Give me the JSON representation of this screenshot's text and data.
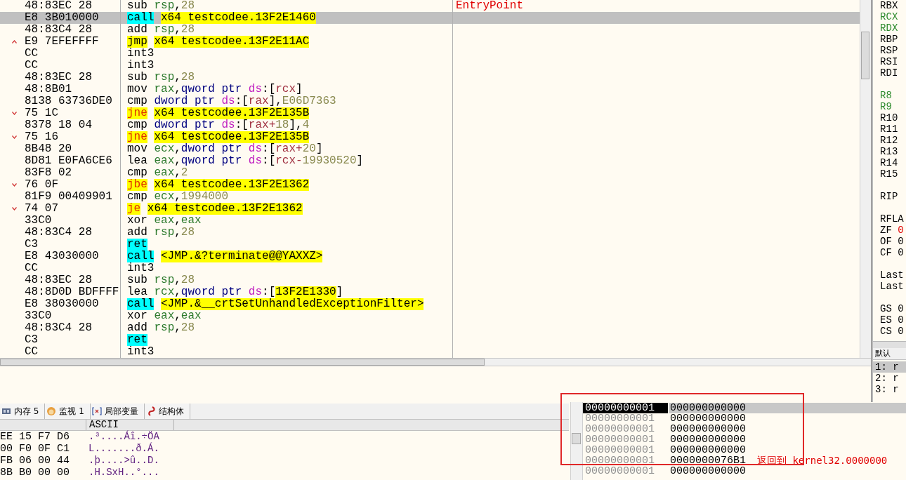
{
  "disassembly": {
    "rows": [
      {
        "bytes": "48:83EC 28",
        "jump_up": false,
        "jump_down": false,
        "selected": false,
        "mnemonic": "sub",
        "kind": "plain",
        "operands": [
          {
            "text": "rsp",
            "kind": "reg"
          },
          {
            "text": ",",
            "kind": "sym"
          },
          {
            "text": "28",
            "kind": "num"
          }
        ],
        "comment": "EntryPoint"
      },
      {
        "bytes": "E8 3B010000",
        "jump_up": false,
        "jump_down": false,
        "selected": true,
        "mnemonic": "call",
        "kind": "call",
        "operands": [
          {
            "text": "x64 testcodee.13F2E1460",
            "kind": "target"
          }
        ]
      },
      {
        "bytes": "48:83C4 28",
        "jump_up": false,
        "jump_down": false,
        "selected": false,
        "mnemonic": "add",
        "kind": "plain",
        "operands": [
          {
            "text": "rsp",
            "kind": "reg"
          },
          {
            "text": ",",
            "kind": "sym"
          },
          {
            "text": "28",
            "kind": "num"
          }
        ]
      },
      {
        "bytes": "E9 7EFEFFFF",
        "jump_up": true,
        "jump_down": false,
        "selected": false,
        "mnemonic": "jmp",
        "kind": "jmp",
        "operands": [
          {
            "text": "x64 testcodee.13F2E11AC",
            "kind": "target"
          }
        ]
      },
      {
        "bytes": "CC",
        "jump_up": false,
        "jump_down": false,
        "selected": false,
        "mnemonic": "int3",
        "kind": "plain",
        "operands": []
      },
      {
        "bytes": "CC",
        "jump_up": false,
        "jump_down": false,
        "selected": false,
        "mnemonic": "int3",
        "kind": "plain",
        "operands": []
      },
      {
        "bytes": "48:83EC 28",
        "jump_up": false,
        "jump_down": false,
        "selected": false,
        "mnemonic": "sub",
        "kind": "plain",
        "operands": [
          {
            "text": "rsp",
            "kind": "reg"
          },
          {
            "text": ",",
            "kind": "sym"
          },
          {
            "text": "28",
            "kind": "num"
          }
        ]
      },
      {
        "bytes": "48:8B01",
        "jump_up": false,
        "jump_down": false,
        "selected": false,
        "mnemonic": "mov",
        "kind": "plain",
        "operands": [
          {
            "text": "rax",
            "kind": "reg"
          },
          {
            "text": ",",
            "kind": "sym"
          },
          {
            "text": "qword ptr ",
            "kind": "size"
          },
          {
            "text": "ds",
            "kind": "seg"
          },
          {
            "text": ":[",
            "kind": "sym"
          },
          {
            "text": "rcx",
            "kind": "memreg"
          },
          {
            "text": "]",
            "kind": "sym"
          }
        ]
      },
      {
        "bytes": "8138 63736DE0",
        "jump_up": false,
        "jump_down": false,
        "selected": false,
        "mnemonic": "cmp",
        "kind": "plain",
        "operands": [
          {
            "text": "dword ptr ",
            "kind": "size"
          },
          {
            "text": "ds",
            "kind": "seg"
          },
          {
            "text": ":[",
            "kind": "sym"
          },
          {
            "text": "rax",
            "kind": "memreg"
          },
          {
            "text": "],",
            "kind": "sym"
          },
          {
            "text": "E06D7363",
            "kind": "num"
          }
        ]
      },
      {
        "bytes": "75 1C",
        "jump_up": false,
        "jump_down": true,
        "selected": false,
        "mnemonic": "jne",
        "kind": "jcc",
        "operands": [
          {
            "text": "x64 testcodee.13F2E135B",
            "kind": "target"
          }
        ]
      },
      {
        "bytes": "8378 18 04",
        "jump_up": false,
        "jump_down": false,
        "selected": false,
        "mnemonic": "cmp",
        "kind": "plain",
        "operands": [
          {
            "text": "dword ptr ",
            "kind": "size"
          },
          {
            "text": "ds",
            "kind": "seg"
          },
          {
            "text": ":[",
            "kind": "sym"
          },
          {
            "text": "rax",
            "kind": "memreg"
          },
          {
            "text": "+",
            "kind": "memreg"
          },
          {
            "text": "18",
            "kind": "num"
          },
          {
            "text": "],",
            "kind": "sym"
          },
          {
            "text": "4",
            "kind": "num"
          }
        ]
      },
      {
        "bytes": "75 16",
        "jump_up": false,
        "jump_down": true,
        "selected": false,
        "mnemonic": "jne",
        "kind": "jcc",
        "operands": [
          {
            "text": "x64 testcodee.13F2E135B",
            "kind": "target"
          }
        ]
      },
      {
        "bytes": "8B48 20",
        "jump_up": false,
        "jump_down": false,
        "selected": false,
        "mnemonic": "mov",
        "kind": "plain",
        "operands": [
          {
            "text": "ecx",
            "kind": "reg"
          },
          {
            "text": ",",
            "kind": "sym"
          },
          {
            "text": "dword ptr ",
            "kind": "size"
          },
          {
            "text": "ds",
            "kind": "seg"
          },
          {
            "text": ":[",
            "kind": "sym"
          },
          {
            "text": "rax",
            "kind": "memreg"
          },
          {
            "text": "+",
            "kind": "memreg"
          },
          {
            "text": "20",
            "kind": "num"
          },
          {
            "text": "]",
            "kind": "sym"
          }
        ]
      },
      {
        "bytes": "8D81 E0FA6CE6",
        "jump_up": false,
        "jump_down": false,
        "selected": false,
        "mnemonic": "lea",
        "kind": "plain",
        "operands": [
          {
            "text": "eax",
            "kind": "reg"
          },
          {
            "text": ",",
            "kind": "sym"
          },
          {
            "text": "qword ptr ",
            "kind": "size"
          },
          {
            "text": "ds",
            "kind": "seg"
          },
          {
            "text": ":[",
            "kind": "sym"
          },
          {
            "text": "rcx",
            "kind": "memreg"
          },
          {
            "text": "-",
            "kind": "memreg"
          },
          {
            "text": "19930520",
            "kind": "num"
          },
          {
            "text": "]",
            "kind": "sym"
          }
        ]
      },
      {
        "bytes": "83F8 02",
        "jump_up": false,
        "jump_down": false,
        "selected": false,
        "mnemonic": "cmp",
        "kind": "plain",
        "operands": [
          {
            "text": "eax",
            "kind": "reg"
          },
          {
            "text": ",",
            "kind": "sym"
          },
          {
            "text": "2",
            "kind": "num"
          }
        ]
      },
      {
        "bytes": "76 0F",
        "jump_up": false,
        "jump_down": true,
        "selected": false,
        "mnemonic": "jbe",
        "kind": "jcc",
        "operands": [
          {
            "text": "x64 testcodee.13F2E1362",
            "kind": "target"
          }
        ]
      },
      {
        "bytes": "81F9 00409901",
        "jump_up": false,
        "jump_down": false,
        "selected": false,
        "mnemonic": "cmp",
        "kind": "plain",
        "operands": [
          {
            "text": "ecx",
            "kind": "reg"
          },
          {
            "text": ",",
            "kind": "sym"
          },
          {
            "text": "1994000",
            "kind": "num"
          }
        ]
      },
      {
        "bytes": "74 07",
        "jump_up": false,
        "jump_down": true,
        "selected": false,
        "mnemonic": "je",
        "kind": "jcc",
        "operands": [
          {
            "text": "x64 testcodee.13F2E1362",
            "kind": "target"
          }
        ]
      },
      {
        "bytes": "33C0",
        "jump_up": false,
        "jump_down": false,
        "selected": false,
        "mnemonic": "xor",
        "kind": "plain",
        "operands": [
          {
            "text": "eax",
            "kind": "reg"
          },
          {
            "text": ",",
            "kind": "sym"
          },
          {
            "text": "eax",
            "kind": "reg"
          }
        ]
      },
      {
        "bytes": "48:83C4 28",
        "jump_up": false,
        "jump_down": false,
        "selected": false,
        "mnemonic": "add",
        "kind": "plain",
        "operands": [
          {
            "text": "rsp",
            "kind": "reg"
          },
          {
            "text": ",",
            "kind": "sym"
          },
          {
            "text": "28",
            "kind": "num"
          }
        ]
      },
      {
        "bytes": "C3",
        "jump_up": false,
        "jump_down": false,
        "selected": false,
        "mnemonic": "ret",
        "kind": "ret",
        "operands": []
      },
      {
        "bytes": "E8 43030000",
        "jump_up": false,
        "jump_down": false,
        "selected": false,
        "mnemonic": "call",
        "kind": "call",
        "operands": [
          {
            "text": "<JMP.&?terminate@@YAXXZ>",
            "kind": "target"
          }
        ]
      },
      {
        "bytes": "CC",
        "jump_up": false,
        "jump_down": false,
        "selected": false,
        "mnemonic": "int3",
        "kind": "plain",
        "operands": []
      },
      {
        "bytes": "48:83EC 28",
        "jump_up": false,
        "jump_down": false,
        "selected": false,
        "mnemonic": "sub",
        "kind": "plain",
        "operands": [
          {
            "text": "rsp",
            "kind": "reg"
          },
          {
            "text": ",",
            "kind": "sym"
          },
          {
            "text": "28",
            "kind": "num"
          }
        ]
      },
      {
        "bytes": "48:8D0D BDFFFF",
        "jump_up": false,
        "jump_down": false,
        "selected": false,
        "mnemonic": "lea",
        "kind": "plain",
        "operands": [
          {
            "text": "rcx",
            "kind": "reg"
          },
          {
            "text": ",",
            "kind": "sym"
          },
          {
            "text": "qword ptr ",
            "kind": "size"
          },
          {
            "text": "ds",
            "kind": "seg"
          },
          {
            "text": ":[",
            "kind": "sym"
          },
          {
            "text": "13F2E1330",
            "kind": "target"
          },
          {
            "text": "]",
            "kind": "sym"
          }
        ]
      },
      {
        "bytes": "E8 38030000",
        "jump_up": false,
        "jump_down": false,
        "selected": false,
        "mnemonic": "call",
        "kind": "call",
        "operands": [
          {
            "text": "<JMP.&__crtSetUnhandledExceptionFilter>",
            "kind": "target"
          }
        ]
      },
      {
        "bytes": "33C0",
        "jump_up": false,
        "jump_down": false,
        "selected": false,
        "mnemonic": "xor",
        "kind": "plain",
        "operands": [
          {
            "text": "eax",
            "kind": "reg"
          },
          {
            "text": ",",
            "kind": "sym"
          },
          {
            "text": "eax",
            "kind": "reg"
          }
        ]
      },
      {
        "bytes": "48:83C4 28",
        "jump_up": false,
        "jump_down": false,
        "selected": false,
        "mnemonic": "add",
        "kind": "plain",
        "operands": [
          {
            "text": "rsp",
            "kind": "reg"
          },
          {
            "text": ",",
            "kind": "sym"
          },
          {
            "text": "28",
            "kind": "num"
          }
        ]
      },
      {
        "bytes": "C3",
        "jump_up": false,
        "jump_down": false,
        "selected": false,
        "mnemonic": "ret",
        "kind": "ret",
        "operands": []
      },
      {
        "bytes": "CC",
        "jump_up": false,
        "jump_down": false,
        "selected": false,
        "mnemonic": "int3",
        "kind": "plain",
        "operands": []
      }
    ]
  },
  "registers": {
    "groups": [
      [
        {
          "name": "RBX",
          "modified": false
        },
        {
          "name": "RCX",
          "modified": true
        },
        {
          "name": "RDX",
          "modified": true
        },
        {
          "name": "RBP",
          "modified": false
        },
        {
          "name": "RSP",
          "modified": false
        },
        {
          "name": "RSI",
          "modified": false
        },
        {
          "name": "RDI",
          "modified": false
        }
      ],
      [
        {
          "name": "R8",
          "modified": true
        },
        {
          "name": "R9",
          "modified": true
        },
        {
          "name": "R10",
          "modified": false
        },
        {
          "name": "R11",
          "modified": false
        },
        {
          "name": "R12",
          "modified": false
        },
        {
          "name": "R13",
          "modified": false
        },
        {
          "name": "R14",
          "modified": false
        },
        {
          "name": "R15",
          "modified": false
        }
      ],
      [
        {
          "name": "RIP",
          "modified": false
        }
      ],
      [
        {
          "name": "RFLA",
          "modified": false
        },
        {
          "name": "ZF",
          "value": "0",
          "modified": true
        },
        {
          "name": "OF",
          "value": "0",
          "modified": false
        },
        {
          "name": "CF",
          "value": "0",
          "modified": false
        }
      ],
      [
        {
          "name": "Last",
          "modified": false
        },
        {
          "name": "Last",
          "modified": false
        }
      ],
      [
        {
          "name": "GS",
          "value": "0",
          "modified": false
        },
        {
          "name": "ES",
          "value": "0",
          "modified": false
        },
        {
          "name": "CS",
          "value": "0",
          "modified": false
        }
      ]
    ]
  },
  "call_stack": {
    "tab": "默认",
    "items": [
      {
        "text": "1: r",
        "selected": true
      },
      {
        "text": "2: r",
        "selected": false
      },
      {
        "text": "3: r",
        "selected": false
      }
    ]
  },
  "bottom_tabs": [
    {
      "label": "内存 5"
    },
    {
      "label": "监视 1"
    },
    {
      "label": "局部变量"
    },
    {
      "label": "结构体"
    }
  ],
  "dump": {
    "header": "ASCII",
    "rows": [
      {
        "hex": "EE 15 F7 D6",
        "ascii": ".³....Áî.÷ÖA"
      },
      {
        "hex": "00 F0 0F C1",
        "ascii": "L.......ð.Á."
      },
      {
        "hex": "FB 06 00 44",
        "ascii": ".þ....>û..D."
      },
      {
        "hex": "8B B0 00 00",
        "ascii": ".H.SxH..°..."
      }
    ]
  },
  "stack": {
    "rows": [
      {
        "address": "00000000001",
        "value": "000000000000",
        "selected": true
      },
      {
        "address": "00000000001",
        "value": "000000000000",
        "selected": false
      },
      {
        "address": "00000000001",
        "value": "000000000000",
        "selected": false
      },
      {
        "address": "00000000001",
        "value": "000000000000",
        "selected": false
      },
      {
        "address": "00000000001",
        "value": "000000000000",
        "selected": false
      },
      {
        "address": "00000000001",
        "value": "0000000076B1",
        "comment": "返回到 kernel32.0000000",
        "selected": false
      },
      {
        "address": "00000000001",
        "value": "000000000000",
        "selected": false
      }
    ]
  },
  "annotation": {
    "kind": "rectangle"
  }
}
